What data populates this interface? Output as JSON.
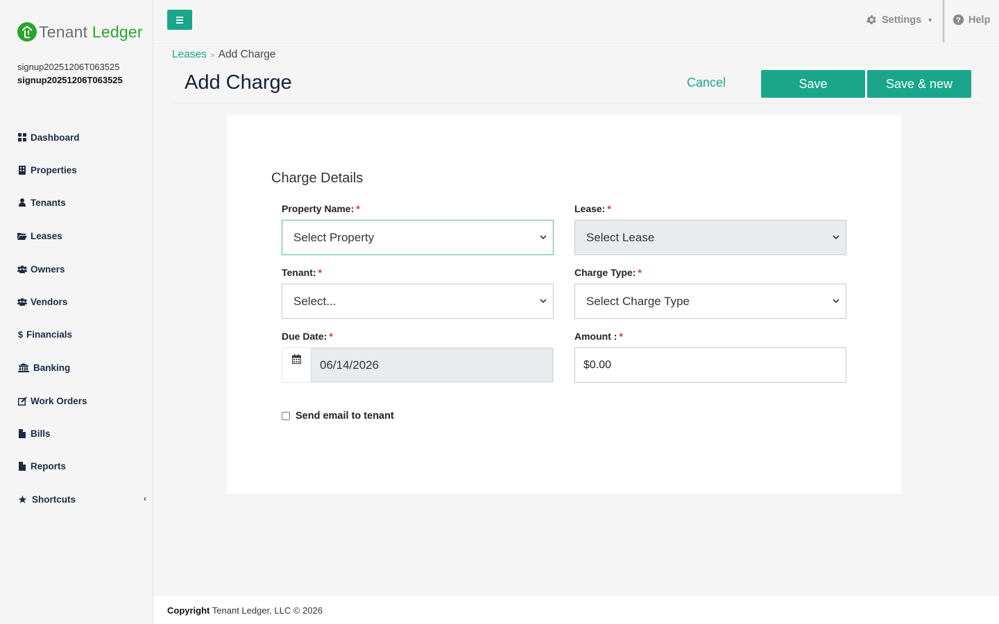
{
  "brand": {
    "name_part1": "Tenant",
    "name_part2": "Ledger",
    "brand_green": "#2aa52a"
  },
  "user": {
    "line1": "signup20251206T063525",
    "line2": "signup20251206T063525"
  },
  "sidebar": {
    "items": [
      {
        "label": "Dashboard",
        "icon": "dashboard-icon"
      },
      {
        "label": "Properties",
        "icon": "building-icon"
      },
      {
        "label": "Tenants",
        "icon": "user-icon"
      },
      {
        "label": "Leases",
        "icon": "folder-open-icon"
      },
      {
        "label": "Owners",
        "icon": "users-icon"
      },
      {
        "label": "Vendors",
        "icon": "users-icon"
      },
      {
        "label": "Financials",
        "icon": "dollar-icon"
      },
      {
        "label": "Banking",
        "icon": "bank-icon"
      },
      {
        "label": "Work Orders",
        "icon": "edit-icon"
      },
      {
        "label": "Bills",
        "icon": "file-icon"
      },
      {
        "label": "Reports",
        "icon": "file-icon"
      },
      {
        "label": "Shortcuts",
        "icon": "star-icon"
      }
    ]
  },
  "topbar": {
    "settings_label": "Settings",
    "help_label": "Help"
  },
  "breadcrumb": {
    "parent": "Leases",
    "current": "Add Charge"
  },
  "header": {
    "title": "Add Charge",
    "cancel_label": "Cancel",
    "save_label": "Save",
    "save_new_label": "Save & new"
  },
  "form": {
    "section_title": "Charge Details",
    "property": {
      "label": "Property Name:",
      "value": "Select Property"
    },
    "lease": {
      "label": "Lease:",
      "value": "Select Lease"
    },
    "tenant": {
      "label": "Tenant:",
      "value": "Select..."
    },
    "charge_type": {
      "label": "Charge Type:",
      "value": "Select Charge Type"
    },
    "due_date": {
      "label": "Due Date:",
      "value": "06/14/2026"
    },
    "amount": {
      "label": "Amount :",
      "value": "$0.00"
    },
    "required_mark": "*",
    "send_email": {
      "label": "Send email to tenant",
      "checked": false
    }
  },
  "footer": {
    "copyright_bold": "Copyright",
    "copyright_rest": "Tenant Ledger, LLC © 2026"
  },
  "colors": {
    "accent": "#1aa68a",
    "required": "#d9342b",
    "title": "#14203a"
  }
}
